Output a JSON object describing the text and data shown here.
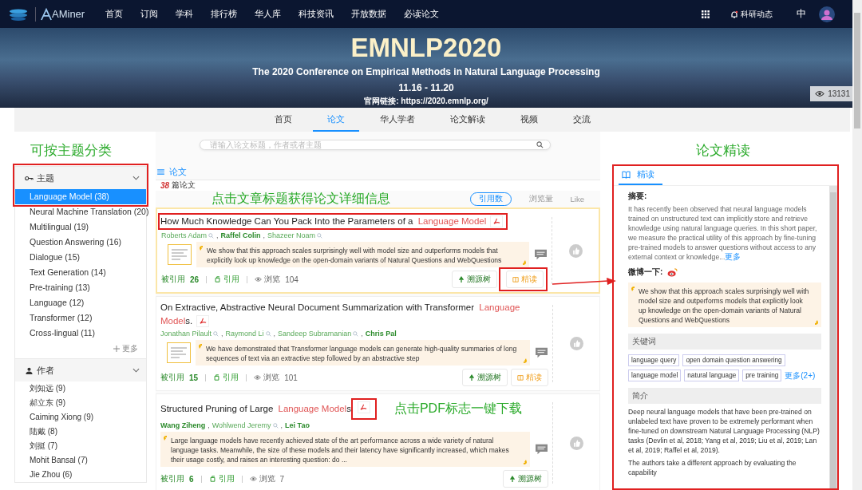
{
  "nav": {
    "logo_text": "AMiner",
    "items": [
      {
        "label": "首页"
      },
      {
        "label": "订阅"
      },
      {
        "label": "学科"
      },
      {
        "label": "排行榜"
      },
      {
        "label": "华人库"
      },
      {
        "label": "科技资讯"
      },
      {
        "label": "开放数据"
      },
      {
        "label": "必读论文"
      }
    ],
    "news": "科研动态",
    "language": "中"
  },
  "banner": {
    "title": "EMNLP2020",
    "subtitle": "The 2020 Conference on Empirical Methods in Natural Language Processing",
    "dates": "11.16 - 11.20",
    "link_label": "官网链接:",
    "link": "https://2020.emnlp.org/",
    "views": "13131"
  },
  "tabs": [
    {
      "label": "首页",
      "selected": false
    },
    {
      "label": "论文",
      "selected": true
    },
    {
      "label": "华人学者",
      "selected": false
    },
    {
      "label": "论文解读",
      "selected": false
    },
    {
      "label": "视频",
      "selected": false
    },
    {
      "label": "交流",
      "selected": false
    }
  ],
  "sidebar": {
    "callout": "可按主题分类",
    "sections": [
      {
        "kind": "topic",
        "title": "主题",
        "expanded": true,
        "framed": true,
        "items": [
          {
            "label": "Language Model (38)",
            "selected": true
          },
          {
            "label": "Neural Machine Translation (20)",
            "selected": false
          },
          {
            "label": "Multilingual (19)",
            "selected": false
          },
          {
            "label": "Question Answering (16)",
            "selected": false
          },
          {
            "label": "Dialogue (15)",
            "selected": false
          },
          {
            "label": "Text Generation (14)",
            "selected": false
          },
          {
            "label": "Pre-training (13)",
            "selected": false
          },
          {
            "label": "Language (12)",
            "selected": false
          },
          {
            "label": "Transformer (12)",
            "selected": false
          },
          {
            "label": "Cross-lingual (11)",
            "selected": false
          }
        ],
        "more": "更多"
      },
      {
        "kind": "author",
        "title": "作者",
        "expanded": true,
        "items": [
          {
            "label": "刘知远 (9)",
            "selected": false
          },
          {
            "label": "郝立东 (9)",
            "selected": false
          },
          {
            "label": "Caiming Xiong (9)",
            "selected": false
          },
          {
            "label": "陆戴 (8)",
            "selected": false
          },
          {
            "label": "刘挺 (7)",
            "selected": false
          },
          {
            "label": "Mohit Bansal (7)",
            "selected": false
          },
          {
            "label": "Jie Zhou (6)",
            "selected": false
          }
        ]
      }
    ]
  },
  "papers_panel": {
    "search": {
      "placeholder": "请输入论文标题，作者或者主题"
    },
    "tab": "论文",
    "count": "38",
    "count_label": "篇论文",
    "callout": "点击文章标题获得论文详细信息",
    "author_separator": ",",
    "sort": [
      {
        "label": "引用数",
        "selected": true
      },
      {
        "label": "浏览量",
        "selected": false
      },
      {
        "label": "Like",
        "selected": false
      }
    ],
    "papers": [
      {
        "title": "How Much Knowledge Can You Pack Into the Parameters of a",
        "highlight": "Language Model",
        "highlighted": true,
        "title_framed": true,
        "authors": [
          {
            "name": "Roberts Adam",
            "kind": "search"
          },
          {
            "name": "Raffel Colin",
            "kind": "profile"
          },
          {
            "name": "Shazeer Noam",
            "kind": "search"
          }
        ],
        "thumbnail": true,
        "abstract": "We show that this approach scales surprisingly well with model size and outperforms models that explicitly look up knowledge on the open-domain variants of Natural Questions and WebQuestions",
        "cited_label": "被引用",
        "cited": "26",
        "cite_label": "引用",
        "views_label": "浏览",
        "views": "104",
        "actions": [
          {
            "label": "溯源树",
            "kind": "tree"
          },
          {
            "label": "精读",
            "kind": "read",
            "framed": true
          }
        ]
      },
      {
        "title": "On Extractive, Abstractive Neural Document Summarization with Transformer",
        "highlight": "Language Model",
        "suffix": "s.",
        "highlighted": false,
        "authors": [
          {
            "name": "Jonathan Pilault",
            "kind": "search"
          },
          {
            "name": "Raymond Li",
            "kind": "search"
          },
          {
            "name": "Sandeep Subramanian",
            "kind": "search"
          },
          {
            "name": "Chris Pal",
            "kind": "profile"
          }
        ],
        "thumbnail": true,
        "abstract": "We have demonstrated that Transformer language models can generate high-quality summaries of long sequences of text via an extractive step followed by an abstractive step",
        "cited_label": "被引用",
        "cited": "15",
        "cite_label": "引用",
        "views_label": "浏览",
        "views": "101",
        "actions": [
          {
            "label": "溯源树",
            "kind": "tree"
          },
          {
            "label": "精读",
            "kind": "read"
          }
        ]
      },
      {
        "title": "Structured Pruning of Large",
        "highlight": "Language Model",
        "suffix": "s",
        "highlighted": false,
        "pdf_framed": true,
        "callout": "点击PDF标志一键下载",
        "authors": [
          {
            "name": "Wang Ziheng",
            "kind": "profile"
          },
          {
            "name": "Wohlwend Jeremy",
            "kind": "search"
          },
          {
            "name": "Lei Tao",
            "kind": "profile"
          }
        ],
        "thumbnail": false,
        "abstract": "Large language models have recently achieved state of the art performance across a wide variety of natural language tasks. Meanwhile, the size of these models and their latency have significantly increased, which makes their usage costly, and raises an interesting question: do ...",
        "cited_label": "被引用",
        "cited": "6",
        "cite_label": "引用",
        "views_label": "浏览",
        "views": "7",
        "actions": [
          {
            "label": "溯源树",
            "kind": "tree"
          }
        ]
      }
    ]
  },
  "reader": {
    "callout": "论文精读",
    "tab": "精读",
    "abstract_label": "摘要:",
    "abstract": "It has recently been observed that neural language models trained on unstructured text can implicitly store and retrieve knowledge using natural language queries. In this short paper, we measure the practical utility of this approach by fine-tuning pre-trained models to answer questions without access to any external context or knowledge...",
    "abstract_more": "更多",
    "weibo_label": "微博一下:",
    "quote": "We show that this approach scales surprisingly well with model size and outperforms models that explicitly look up knowledge on the open-domain variants of Natural Questions and WebQuestions",
    "keywords_label": "关键词",
    "keywords": [
      "language query",
      "open domain question answering",
      "language model",
      "natural language",
      "pre training"
    ],
    "keywords_more": "更多(2+)",
    "intro_label": "简介",
    "intro": [
      "Deep neural language models that have been pre-trained on unlabeled text have proven to be extremely performant when fine-tuned on downstream Natural Language Processing (NLP) tasks (Devlin et al, 2018; Yang et al, 2019; Liu et al, 2019; Lan et al, 2019; Raffel et al, 2019).",
      "The authors take a different approach by evaluating the capability"
    ]
  }
}
